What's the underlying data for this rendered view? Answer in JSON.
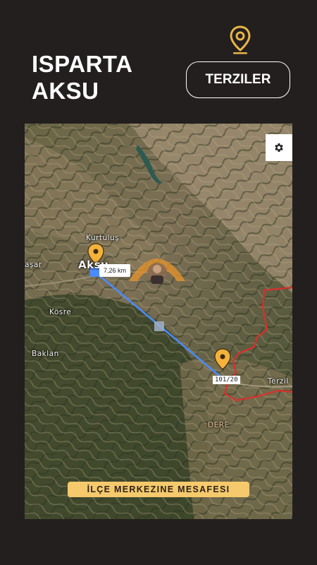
{
  "header": {
    "title_line1": "ISPARTA",
    "title_line2": "AKSU",
    "button_label": "TERZILER",
    "top_icon": "location-pin-icon"
  },
  "map": {
    "settings_icon": "gear-icon",
    "distance_label": "7,26 km",
    "destination_badge": "101/20",
    "caption": "İLÇE MERKEZINE MESAFESI",
    "place_labels": {
      "kurtulus": "Kurtuluş",
      "asar": "aşar",
      "aksu": "Aksu",
      "kosre": "Kösre",
      "baklan": "Baklan",
      "terzil": "Terzil",
      "dere": "DERE"
    },
    "colors": {
      "route": "#4a8cff",
      "pin": "#f4b23b",
      "boundary": "#d9302c",
      "caption_bg": "#f5c96c"
    }
  }
}
